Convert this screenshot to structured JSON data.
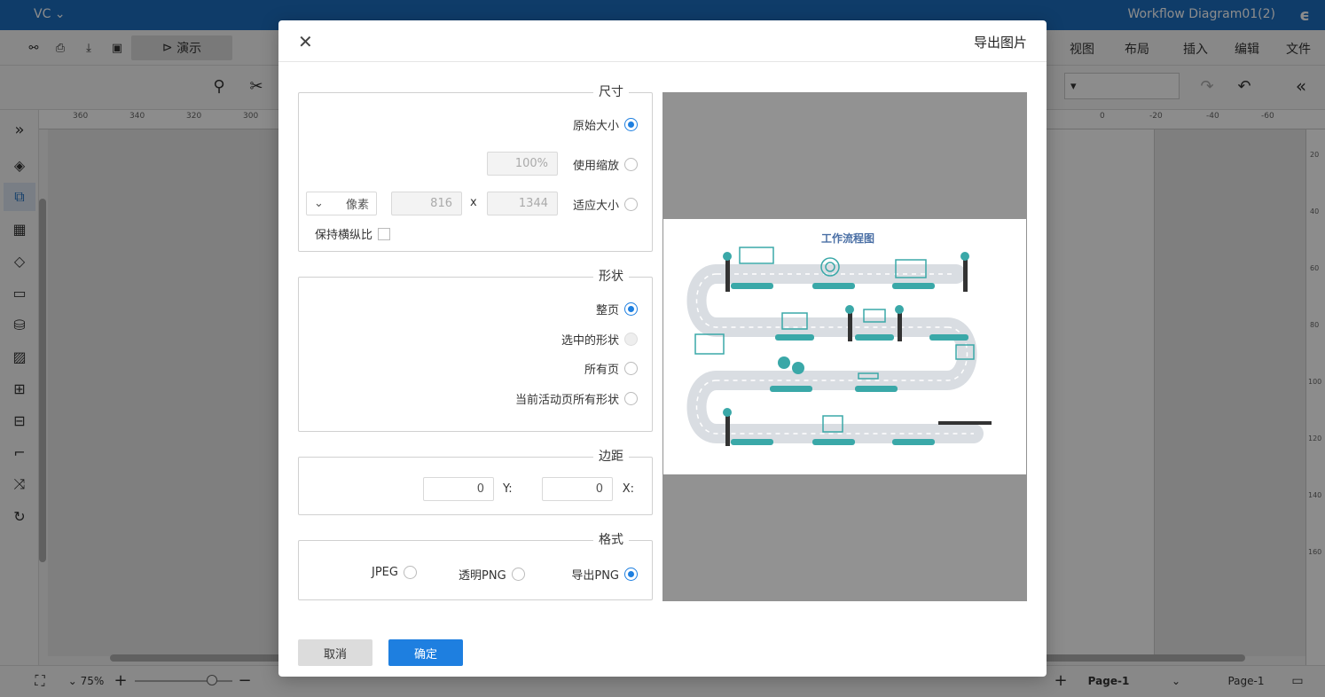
{
  "app": {
    "doc_title": "Workflow Diagram01(2)",
    "user": "VC",
    "menus": [
      "文件",
      "编辑",
      "插入",
      "布局",
      "视图"
    ],
    "present_label": "演示",
    "page_tab": "Page-1",
    "page_select": "Page-1",
    "zoom": "75%",
    "ruler_top_ticks": [
      "-60",
      "-40",
      "-20",
      "0",
      "300",
      "320",
      "340",
      "360"
    ],
    "ruler_left_ticks": [
      "20",
      "40",
      "60",
      "80",
      "100",
      "120",
      "140",
      "160"
    ]
  },
  "dialog": {
    "title": "导出图片",
    "size": {
      "legend": "尺寸",
      "original": "原始大小",
      "use_scale": "使用缩放",
      "scale_value": "100%",
      "fit_size": "适应大小",
      "width": "1344",
      "x_sep": "x",
      "height": "816",
      "unit": "像素",
      "keep_ratio": "保持横纵比"
    },
    "shape": {
      "legend": "形状",
      "whole_page": "整页",
      "selected": "选中的形状",
      "all_pages": "所有页",
      "current_page_all": "当前活动页所有形状"
    },
    "margin": {
      "legend": "边距",
      "x_label": "X:",
      "x_value": "0",
      "y_label": "Y:",
      "y_value": "0"
    },
    "format": {
      "legend": "格式",
      "png": "导出PNG",
      "transparent_png": "透明PNG",
      "jpeg": "JPEG"
    },
    "preview_title": "工作流程图",
    "ok": "确定",
    "cancel": "取消"
  },
  "colors": {
    "accent": "#1e7fe0",
    "titlebar": "#1d6ec0",
    "teal": "#3aa8a8"
  }
}
